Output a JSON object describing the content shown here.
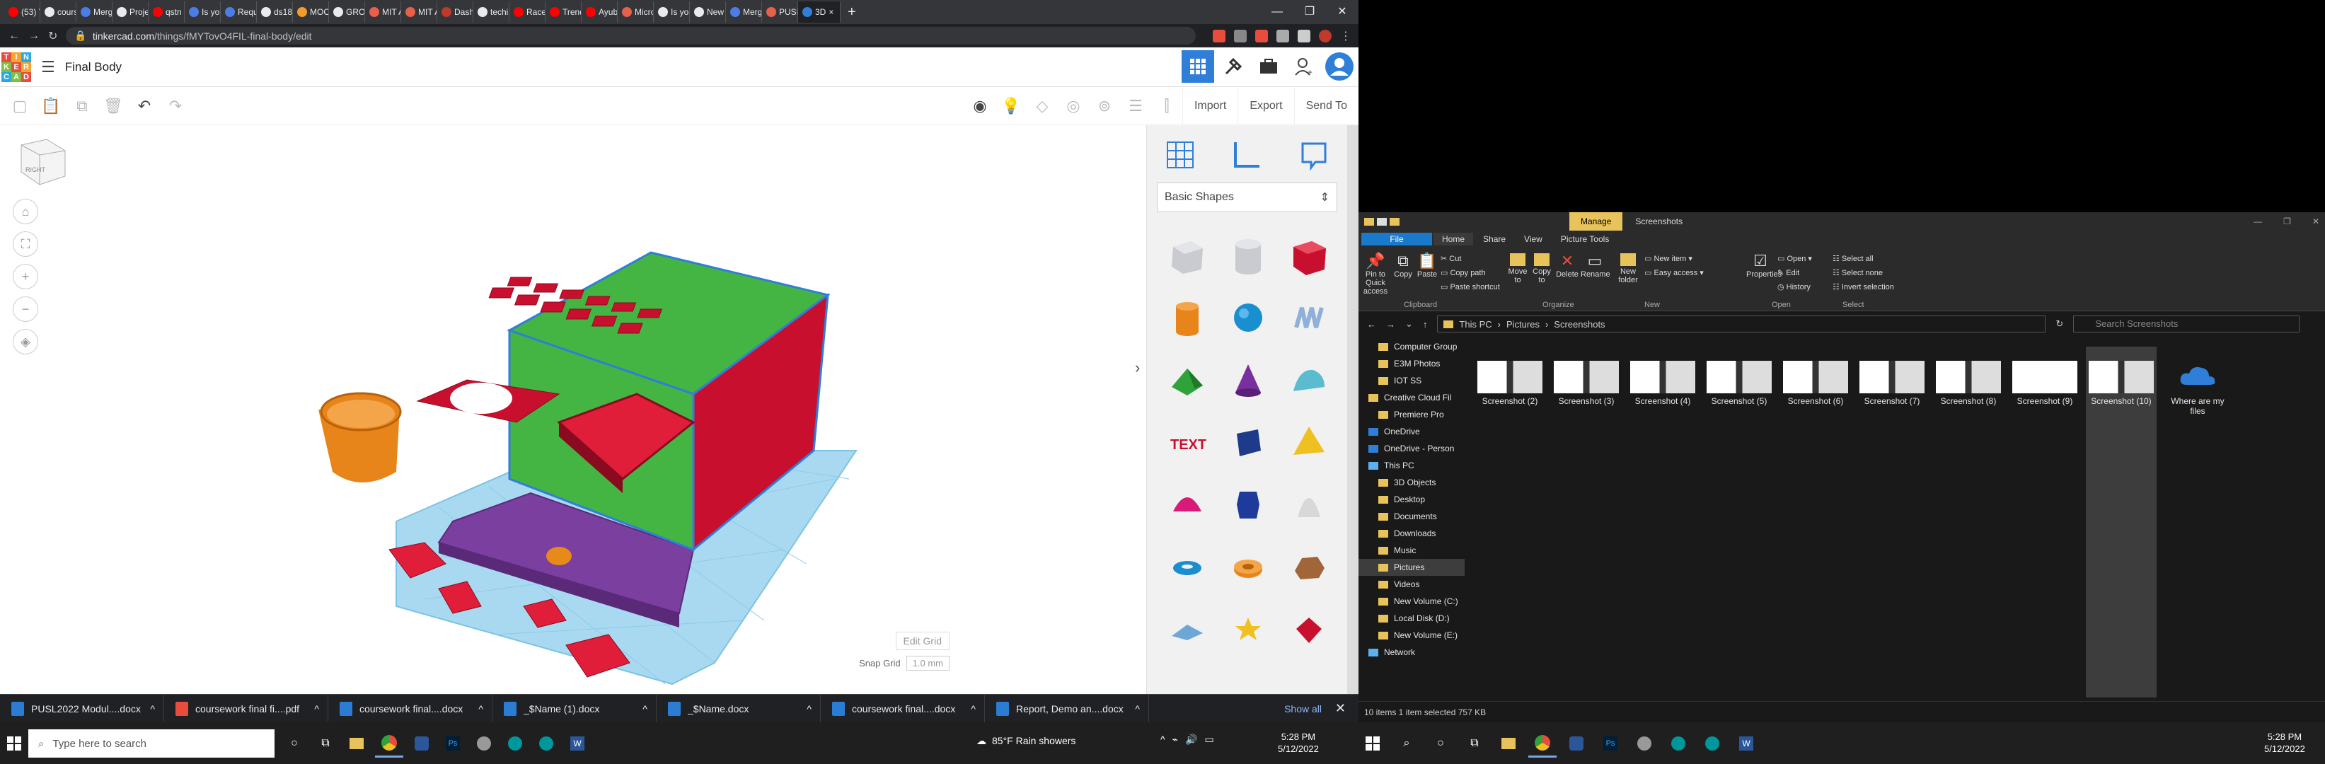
{
  "browser": {
    "tabs": [
      {
        "label": "(53) Y",
        "color": "#ff0000"
      },
      {
        "label": "cours",
        "color": "#e8eaed"
      },
      {
        "label": "Merg",
        "color": "#4a7de8"
      },
      {
        "label": "Proje",
        "color": "#e8eaed"
      },
      {
        "label": "qstn",
        "color": "#ff0000"
      },
      {
        "label": "Is you",
        "color": "#4a7de8"
      },
      {
        "label": "Requ",
        "color": "#4a7de8"
      },
      {
        "label": "ds18",
        "color": "#e8eaed"
      },
      {
        "label": "MOO",
        "color": "#f49b28"
      },
      {
        "label": "GRO",
        "color": "#e8eaed"
      },
      {
        "label": "MIT A",
        "color": "#e8604a"
      },
      {
        "label": "MIT A",
        "color": "#e8604a"
      },
      {
        "label": "Dash",
        "color": "#c0392b"
      },
      {
        "label": "techi",
        "color": "#e8eaed"
      },
      {
        "label": "Race",
        "color": "#ff0000"
      },
      {
        "label": "Trend",
        "color": "#ff0000"
      },
      {
        "label": "Ayub",
        "color": "#ff0000"
      },
      {
        "label": "Micro",
        "color": "#e8604a"
      },
      {
        "label": "Is you",
        "color": "#e8eaed"
      },
      {
        "label": "New",
        "color": "#e8eaed"
      },
      {
        "label": "Merg",
        "color": "#4a7de8"
      },
      {
        "label": "PUSL",
        "color": "#e8604a"
      },
      {
        "label": "3D",
        "color": "#2f7fd9"
      }
    ],
    "new_tab": "+",
    "url_host": "tinkercad.com",
    "url_path": "/things/fMYTovO4FIL-final-body/edit"
  },
  "tinkercad": {
    "logo_letters": [
      "T",
      "I",
      "N",
      "K",
      "E",
      "R",
      "C",
      "A",
      "D"
    ],
    "logo_colors": [
      "#e84c3d",
      "#f3a530",
      "#2aa9e0",
      "#7fbf3f",
      "#e84c3d",
      "#f3a530",
      "#2aa9e0",
      "#7fbf3f",
      "#e84c3d"
    ],
    "design_title": "Final Body",
    "import": "Import",
    "export": "Export",
    "send_to": "Send To",
    "shape_category": "Basic Shapes",
    "edit_grid": "Edit Grid",
    "snap_grid_label": "Snap Grid",
    "snap_grid_value": "1.0 mm",
    "viewcube_label": "RIGHT"
  },
  "downloads": {
    "items": [
      {
        "name": "PUSL2022 Modul....docx",
        "color": "#2b7cd3"
      },
      {
        "name": "coursework final fi....pdf",
        "color": "#e84c3d"
      },
      {
        "name": "coursework final....docx",
        "color": "#2b7cd3"
      },
      {
        "name": "_$Name (1).docx",
        "color": "#2b7cd3"
      },
      {
        "name": "_$Name.docx",
        "color": "#2b7cd3"
      },
      {
        "name": "coursework final....docx",
        "color": "#2b7cd3"
      },
      {
        "name": "Report, Demo an....docx",
        "color": "#2b7cd3"
      }
    ],
    "show_all": "Show all"
  },
  "taskbar": {
    "search_placeholder": "Type here to search",
    "weather": "85°F  Rain showers",
    "time": "5:28 PM",
    "date": "5/12/2022"
  },
  "explorer": {
    "manage": "Manage",
    "title": "Screenshots",
    "ribbon_tabs": [
      "File",
      "Home",
      "Share",
      "View",
      "Picture Tools"
    ],
    "clipboard": {
      "pin": "Pin to Quick access",
      "copy": "Copy",
      "paste": "Paste",
      "cut": "Cut",
      "copy_path": "Copy path",
      "paste_shortcut": "Paste shortcut",
      "label": "Clipboard"
    },
    "organize": {
      "move": "Move to",
      "copy": "Copy to",
      "delete": "Delete",
      "rename": "Rename",
      "label": "Organize"
    },
    "new": {
      "folder": "New folder",
      "item": "New item",
      "easy": "Easy access",
      "label": "New"
    },
    "open": {
      "properties": "Properties",
      "open": "Open",
      "edit": "Edit",
      "history": "History",
      "label": "Open"
    },
    "select": {
      "all": "Select all",
      "none": "Select none",
      "invert": "Invert selection",
      "label": "Select"
    },
    "path": [
      "This PC",
      "Pictures",
      "Screenshots"
    ],
    "search_placeholder": "Search Screenshots",
    "nav": [
      {
        "label": "Computer Group",
        "sub": true
      },
      {
        "label": "E3M Photos",
        "sub": true
      },
      {
        "label": "IOT SS",
        "sub": true
      },
      {
        "label": "Creative Cloud Fil",
        "sub": false
      },
      {
        "label": "Premiere Pro",
        "sub": true
      },
      {
        "label": "OneDrive",
        "sub": false
      },
      {
        "label": "OneDrive - Person",
        "sub": false
      },
      {
        "label": "This PC",
        "sub": false
      },
      {
        "label": "3D Objects",
        "sub": true
      },
      {
        "label": "Desktop",
        "sub": true
      },
      {
        "label": "Documents",
        "sub": true
      },
      {
        "label": "Downloads",
        "sub": true
      },
      {
        "label": "Music",
        "sub": true
      },
      {
        "label": "Pictures",
        "sub": true
      },
      {
        "label": "Videos",
        "sub": true
      },
      {
        "label": "New Volume (C:)",
        "sub": true
      },
      {
        "label": "Local Disk (D:)",
        "sub": true
      },
      {
        "label": "New Volume (E:)",
        "sub": true
      },
      {
        "label": "Network",
        "sub": false
      }
    ],
    "files": [
      "Screenshot (2)",
      "Screenshot (3)",
      "Screenshot (4)",
      "Screenshot (5)",
      "Screenshot (6)",
      "Screenshot (7)",
      "Screenshot (8)",
      "Screenshot (9)",
      "Screenshot (10)",
      "Where are my files"
    ],
    "status": "10 items    1 item selected  757 KB"
  }
}
